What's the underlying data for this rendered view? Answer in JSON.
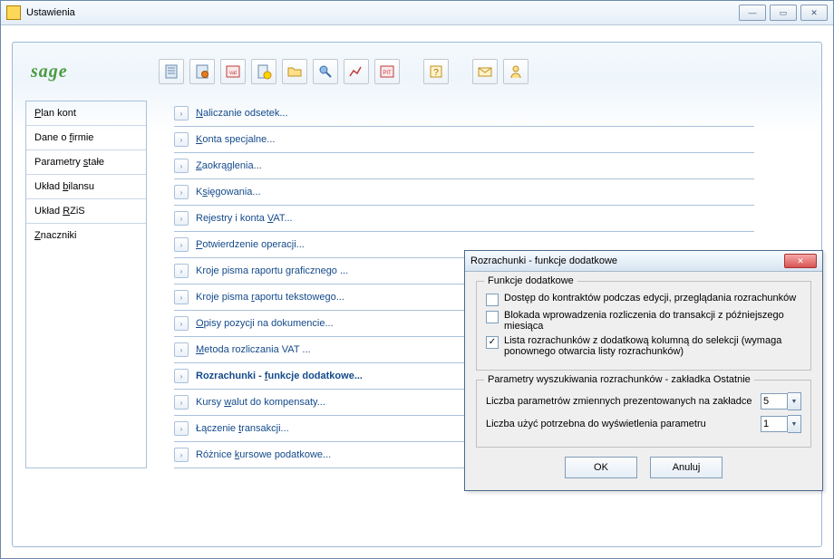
{
  "window": {
    "title": "Ustawienia"
  },
  "logo": "sage",
  "sidebar": {
    "items": [
      {
        "prefix": "",
        "u": "P",
        "suffix": "lan kont"
      },
      {
        "prefix": "Dane o ",
        "u": "f",
        "suffix": "irmie"
      },
      {
        "prefix": "Parametry ",
        "u": "s",
        "suffix": "tałe"
      },
      {
        "prefix": "Układ ",
        "u": "b",
        "suffix": "ilansu"
      },
      {
        "prefix": "Układ ",
        "u": "R",
        "suffix": "ZiS"
      },
      {
        "prefix": "",
        "u": "Z",
        "suffix": "naczniki"
      }
    ]
  },
  "links": [
    {
      "prefix": "",
      "u": "N",
      "suffix": "aliczanie odsetek..."
    },
    {
      "prefix": "",
      "u": "K",
      "suffix": "onta specjalne..."
    },
    {
      "prefix": "",
      "u": "Z",
      "suffix": "aokrąglenia..."
    },
    {
      "prefix": "K",
      "u": "s",
      "suffix": "ięgowania..."
    },
    {
      "prefix": "Rejestry i konta ",
      "u": "V",
      "suffix": "AT..."
    },
    {
      "prefix": "",
      "u": "P",
      "suffix": "otwierdzenie operacji..."
    },
    {
      "prefix": "Kroje pisma raportu ",
      "u": "g",
      "suffix": "raficznego ..."
    },
    {
      "prefix": "Kroje pisma ",
      "u": "r",
      "suffix": "aportu tekstowego..."
    },
    {
      "prefix": "",
      "u": "O",
      "suffix": "pisy pozycji na dokumencie..."
    },
    {
      "prefix": "",
      "u": "M",
      "suffix": "etoda rozliczania VAT ..."
    },
    {
      "prefix": "Rozrachunki - ",
      "u": "f",
      "suffix": "unkcje dodatkowe...",
      "active": true
    },
    {
      "prefix": "Kursy ",
      "u": "w",
      "suffix": "alut do kompensaty..."
    },
    {
      "prefix": "Łączenie ",
      "u": "t",
      "suffix": "ransakcji..."
    },
    {
      "prefix": "Różnice ",
      "u": "k",
      "suffix": "ursowe podatkowe..."
    }
  ],
  "dialog": {
    "title": "Rozrachunki - funkcje dodatkowe",
    "group1": {
      "title": "Funkcje dodatkowe",
      "opt1": "Dostęp do kontraktów podczas edycji, przeglądania rozrachunków",
      "opt2": "Blokada wprowadzenia rozliczenia do transakcji z późniejszego miesiąca",
      "opt3": "Lista rozrachunków z dodatkową kolumną do selekcji (wymaga ponownego otwarcia listy rozrachunków)",
      "chk1": false,
      "chk2": false,
      "chk3": true
    },
    "group2": {
      "title": "Parametry wyszukiwania rozrachunków - zakładka Ostatnie",
      "row1_label": "Liczba parametrów zmiennych prezentowanych na zakładce",
      "row1_value": "5",
      "row2_label": "Liczba użyć potrzebna do wyświetlenia parametru",
      "row2_value": "1"
    },
    "ok": "OK",
    "cancel": "Anuluj"
  }
}
